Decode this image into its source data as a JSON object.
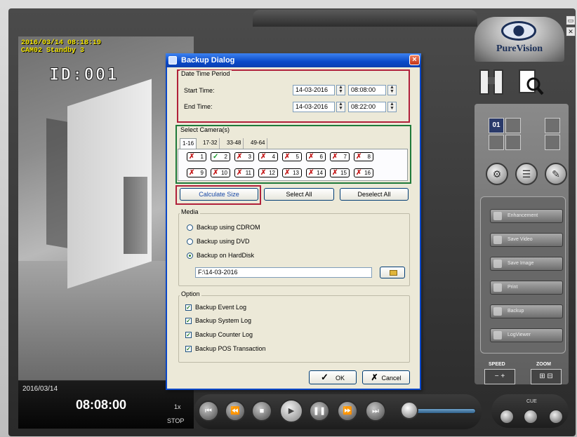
{
  "osd": {
    "timestamp": "2016/03/14 08:18:19",
    "camera": "CAM02 Standby 3",
    "id": "ID:001"
  },
  "playback": {
    "date": "2016/03/14",
    "time": "08:08:00",
    "speed": "1x",
    "state": "STOP"
  },
  "brand": {
    "logo": "PureVision"
  },
  "panel": {
    "channel_label": "01",
    "functions": [
      "Enhancement",
      "Save Video",
      "Save Image",
      "Print",
      "Backup",
      "LogViewer"
    ],
    "speed_label": "SPEED",
    "zoom_label": "ZOOM",
    "cue_label": "CUE"
  },
  "dialog": {
    "title": "Backup Dialog",
    "close": "×",
    "datetime": {
      "group": "Date Time Period",
      "start_label": "Start Time:",
      "start_date": "14-03-2016",
      "start_time": "08:08:00",
      "end_label": "End Time:",
      "end_date": "14-03-2016",
      "end_time": "08:22:00"
    },
    "cameras": {
      "group": "Select Camera(s)",
      "tabs": [
        "1-16",
        "17-32",
        "33-48",
        "49-64"
      ],
      "row1": [
        "1",
        "2",
        "3",
        "4",
        "5",
        "6",
        "7",
        "8"
      ],
      "row2": [
        "9",
        "10",
        "11",
        "12",
        "13",
        "14",
        "15",
        "16"
      ],
      "selected": [
        "2"
      ]
    },
    "buttons": {
      "calc": "Calculate Size",
      "select_all": "Select All",
      "deselect_all": "Deselect All"
    },
    "media": {
      "group": "Media",
      "options": [
        "Backup using CDROM",
        "Backup using DVD",
        "Backup on HardDisk"
      ],
      "selected": "Backup on HardDisk",
      "path": "F:\\14-03-2016"
    },
    "option": {
      "group": "Option",
      "checks": [
        "Backup Event Log",
        "Backup System Log",
        "Backup Counter Log",
        "Backup POS Transaction"
      ]
    },
    "ok": "OK",
    "cancel": "Cancel",
    "ok_icon": "✓",
    "cancel_icon": "✗"
  },
  "colors": {
    "title_bar": "#0a4ac8",
    "dialog_bg": "#ece9d8",
    "highlight_red": "#b0203a",
    "highlight_green": "#1f7a3a",
    "osd_text": "#f2e400"
  }
}
